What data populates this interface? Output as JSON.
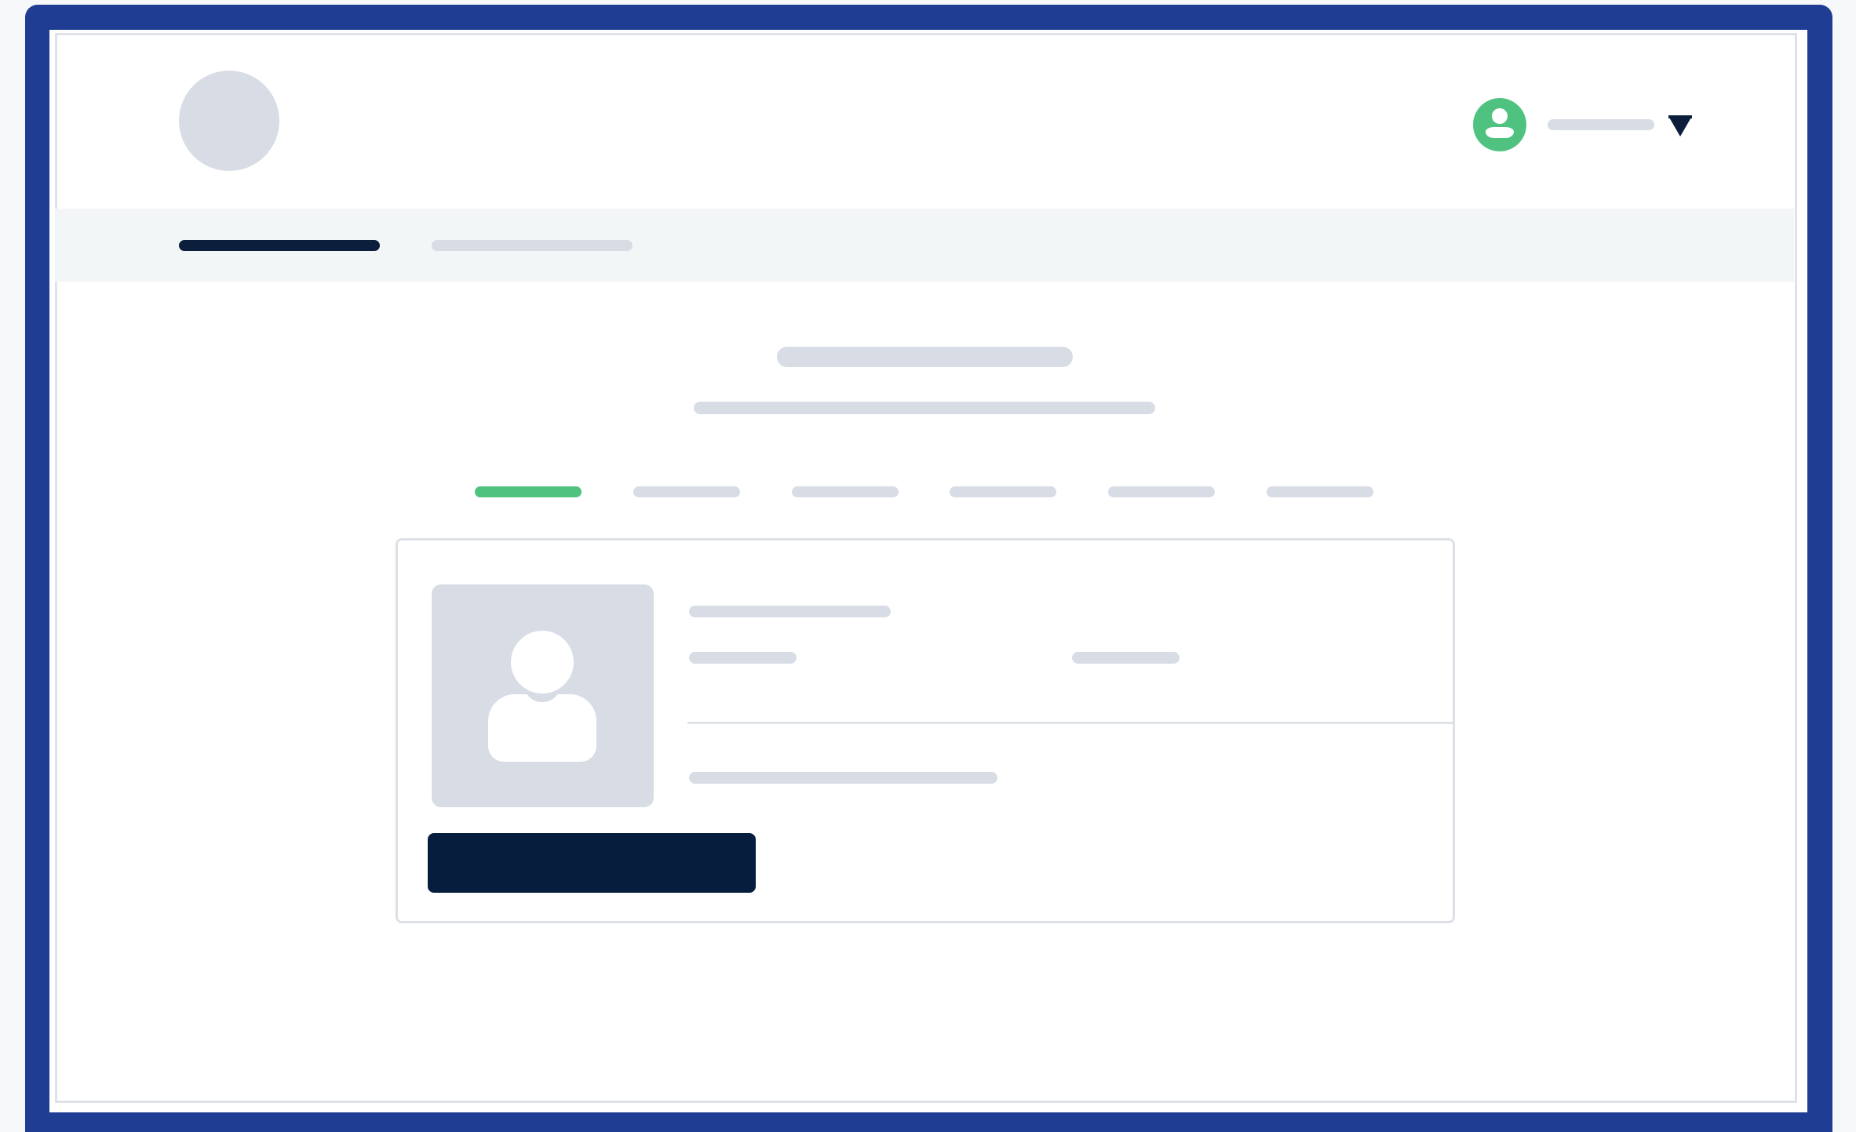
{
  "colors": {
    "frame": "#1e3d93",
    "accent_green": "#4fc27f",
    "dark_navy": "#0b1e3c",
    "skeleton": "#d8dde5",
    "nav_background": "#f3f6f7"
  },
  "header": {
    "logo": "logo-placeholder",
    "user_menu": {
      "avatar_icon": "user-avatar-icon",
      "name": "",
      "dropdown_icon": "caret-down-icon"
    }
  },
  "nav": {
    "active_index": 0,
    "items": [
      {
        "label": ""
      },
      {
        "label": ""
      }
    ]
  },
  "main": {
    "title": "",
    "subtitle": "",
    "steps": {
      "active_index": 0,
      "count": 6
    },
    "card": {
      "photo_icon": "person-placeholder-icon",
      "name": "",
      "detail_left": "",
      "detail_right": "",
      "description": "",
      "button_label": ""
    }
  }
}
